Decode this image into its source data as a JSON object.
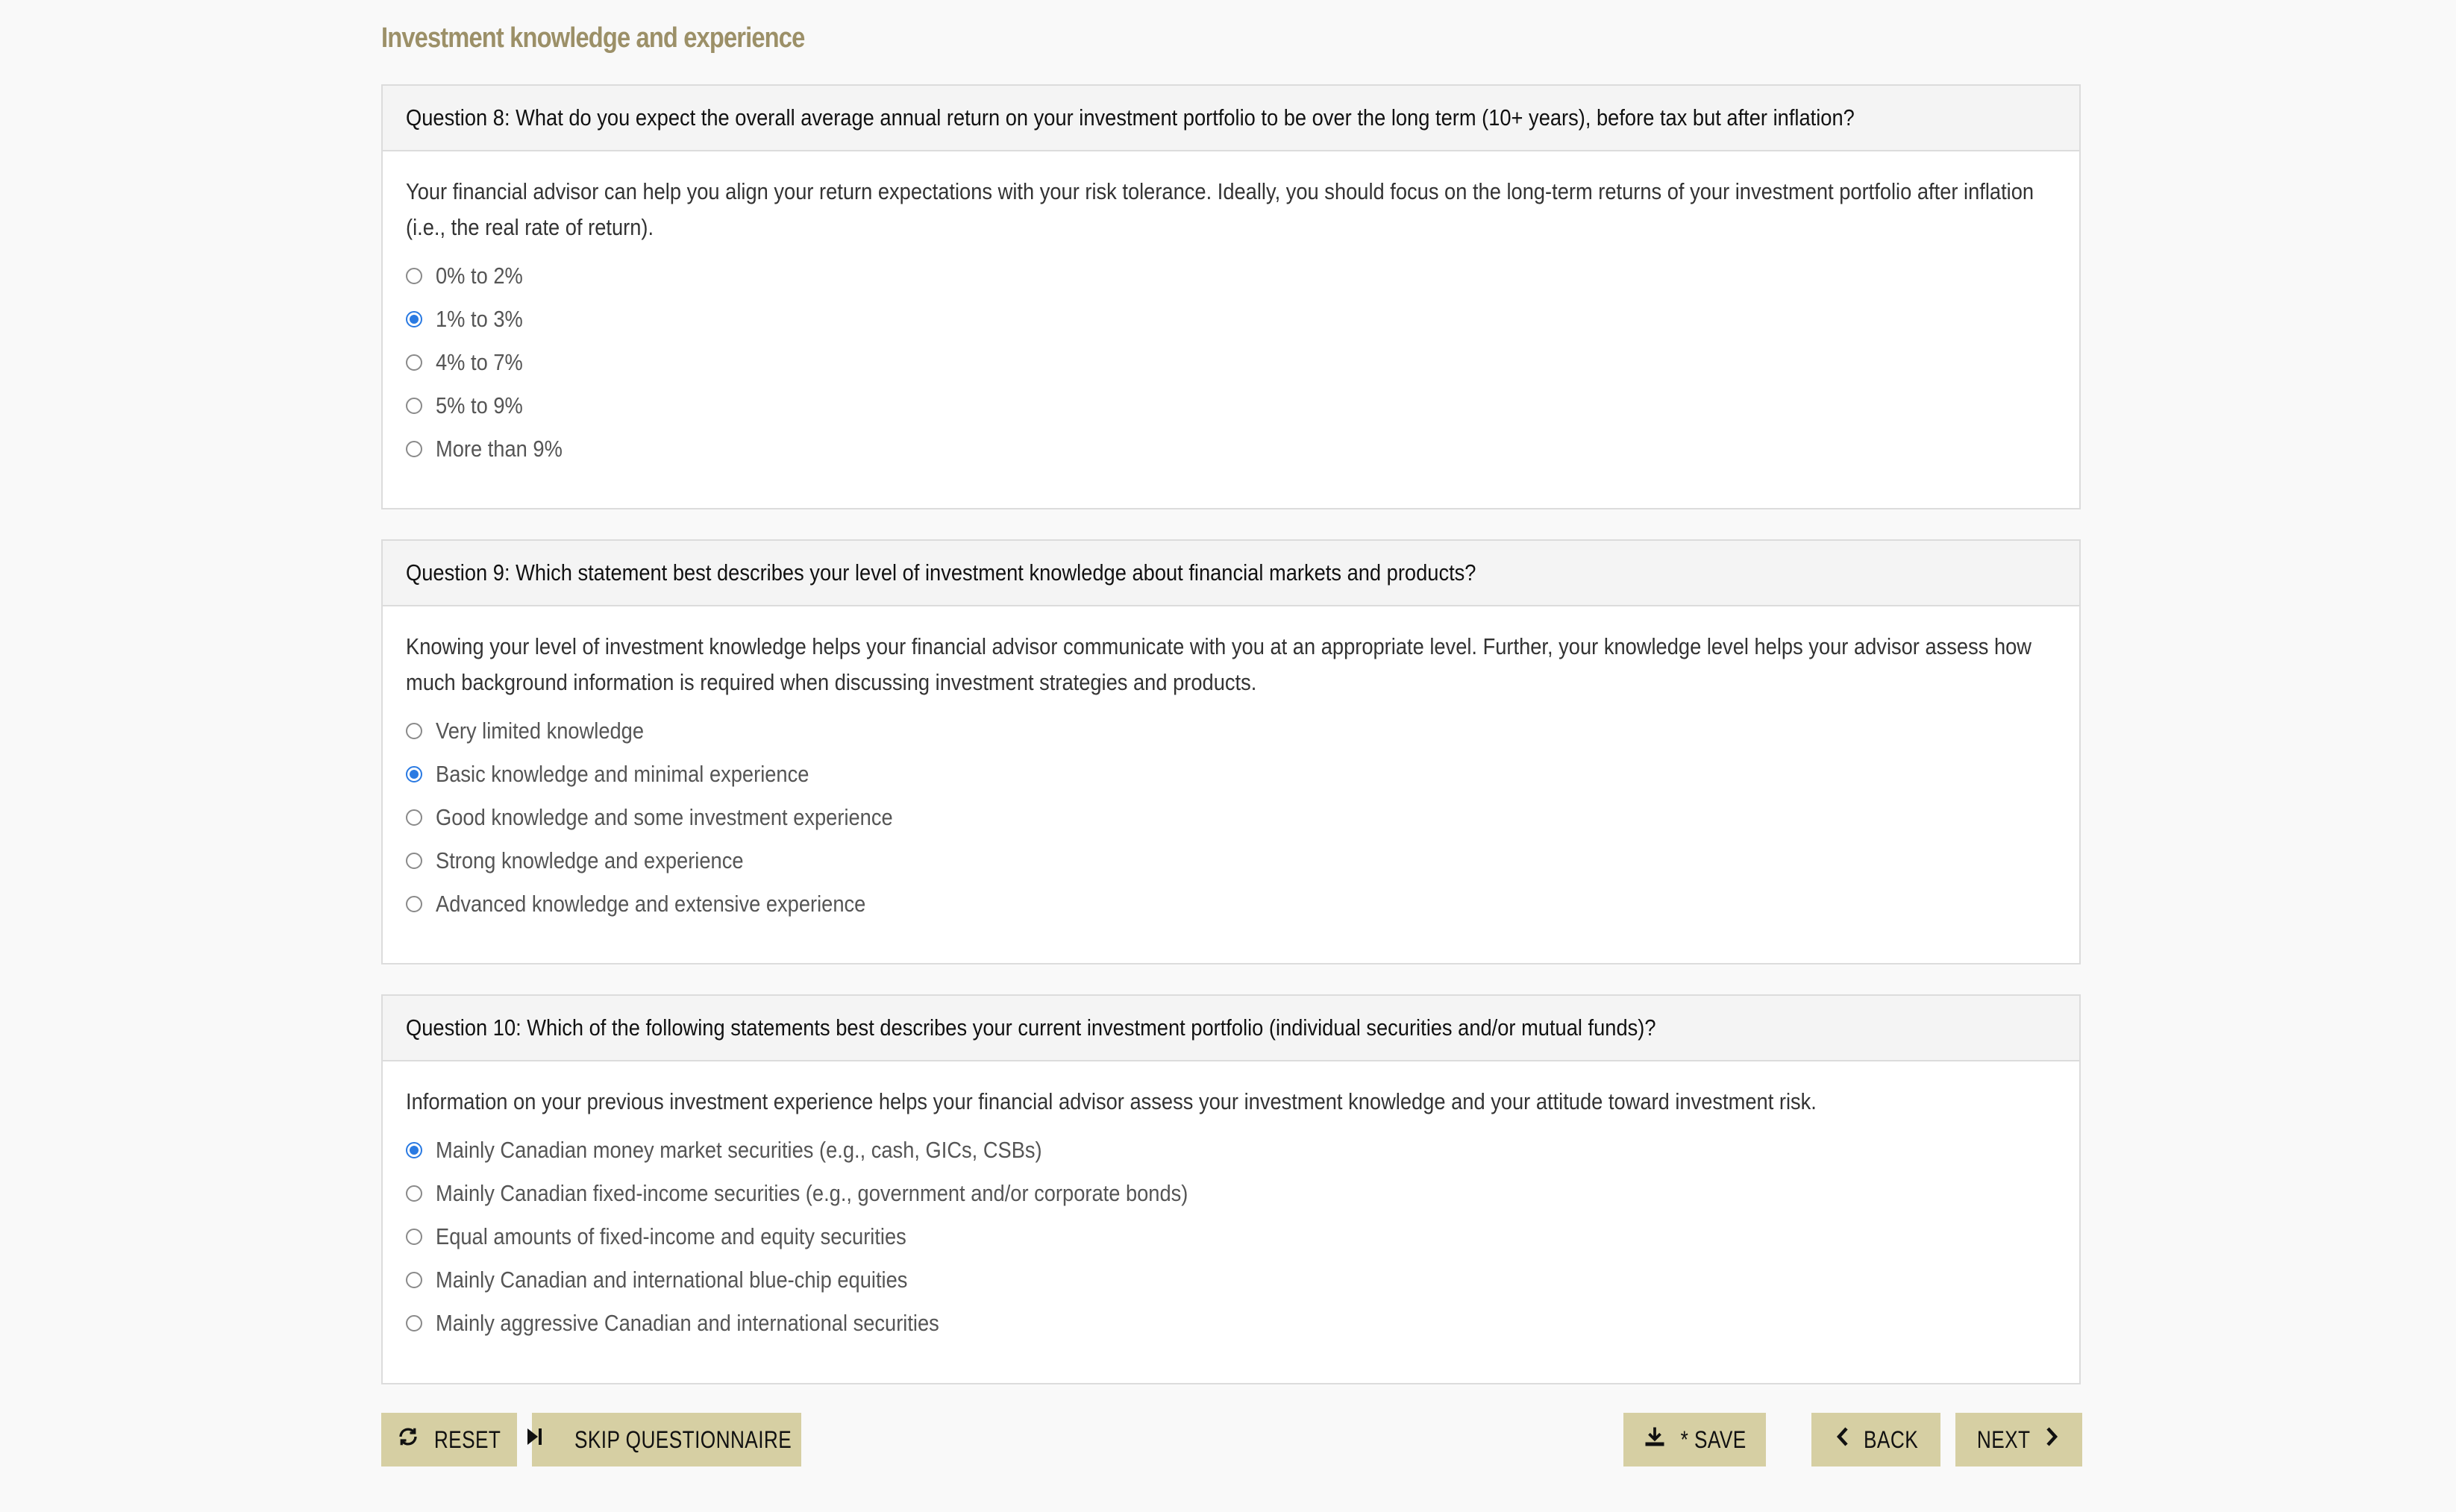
{
  "section_title": "Investment knowledge and experience",
  "questions": [
    {
      "title": "Question 8: What do you expect the overall average annual return on your investment portfolio to be over the long term (10+ years), before tax but after inflation?",
      "description": "Your financial advisor can help you align your return expectations with your risk tolerance. Ideally, you should focus on the long-term returns of your investment portfolio after inflation (i.e., the real rate of return).",
      "options": [
        "0% to 2%",
        "1% to 3%",
        "4% to 7%",
        "5% to 9%",
        "More than 9%"
      ],
      "selected": "1% to 3%"
    },
    {
      "title": "Question 9: Which statement best describes your level of investment knowledge about financial markets and products?",
      "description": "Knowing your level of investment knowledge helps your financial advisor communicate with you at an appropriate level. Further, your knowledge level helps your advisor assess how much background information is required when discussing investment strategies and products.",
      "options": [
        "Very limited knowledge",
        "Basic knowledge and minimal experience",
        "Good knowledge and some investment experience",
        "Strong knowledge and experience",
        "Advanced knowledge and extensive experience"
      ],
      "selected": "Basic knowledge and minimal experience"
    },
    {
      "title": "Question 10: Which of the following statements best describes your current investment portfolio (individual securities and/or mutual funds)?",
      "description": "Information on your previous investment experience helps your financial advisor assess your investment knowledge and your attitude toward investment risk.",
      "options": [
        "Mainly Canadian money market securities (e.g., cash, GICs, CSBs)",
        "Mainly Canadian fixed-income securities (e.g., government and/or corporate bonds)",
        "Equal amounts of fixed-income and equity securities",
        "Mainly Canadian and international blue-chip equities",
        "Mainly aggressive Canadian and international securities"
      ],
      "selected": "Mainly Canadian money market securities (e.g., cash, GICs, CSBs)"
    }
  ],
  "buttons": {
    "reset": "RESET",
    "skip": "SKIP QUESTIONNAIRE",
    "save": "* SAVE",
    "back": "BACK",
    "next": "NEXT"
  },
  "icons": {
    "reset": "refresh-icon",
    "skip": "skip-forward-icon",
    "save": "download-icon",
    "back": "chevron-left-icon",
    "next": "chevron-right-icon"
  },
  "colors": {
    "accent": "#9c9068",
    "button_bg": "#d6cfa3",
    "radio_checked": "#2a7ae2"
  }
}
